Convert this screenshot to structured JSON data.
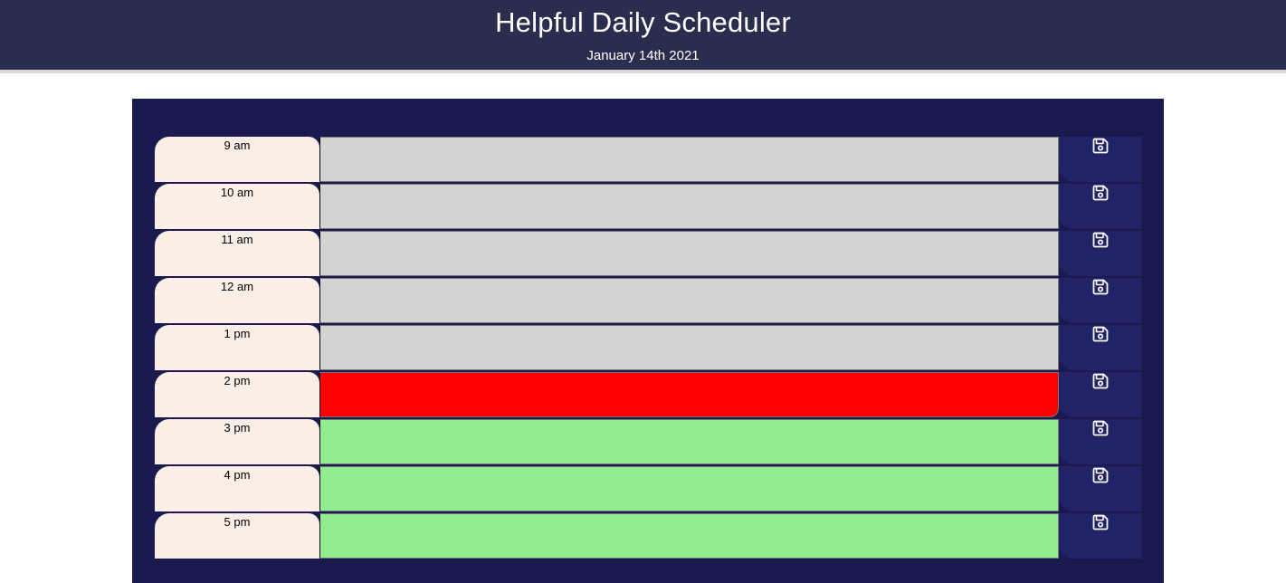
{
  "header": {
    "title": "Helpful Daily Scheduler",
    "date": "January 14th 2021"
  },
  "colors": {
    "header_bg": "#2a2d4e",
    "container_bg": "#1a1a4e",
    "hour_bg": "#f9efe6",
    "past": "#d3d3d3",
    "present": "#ff0000",
    "future": "#90ee90",
    "save_bg": "#222266"
  },
  "time_blocks": [
    {
      "hour": "9 am",
      "status": "past",
      "text": "",
      "save_icon": "save-icon"
    },
    {
      "hour": "10 am",
      "status": "past",
      "text": "",
      "save_icon": "save-icon"
    },
    {
      "hour": "11 am",
      "status": "past",
      "text": "",
      "save_icon": "save-icon"
    },
    {
      "hour": "12 am",
      "status": "past",
      "text": "",
      "save_icon": "save-icon"
    },
    {
      "hour": "1 pm",
      "status": "past",
      "text": "",
      "save_icon": "save-icon"
    },
    {
      "hour": "2 pm",
      "status": "present",
      "text": "",
      "save_icon": "save-icon"
    },
    {
      "hour": "3 pm",
      "status": "future",
      "text": "",
      "save_icon": "save-icon"
    },
    {
      "hour": "4 pm",
      "status": "future",
      "text": "",
      "save_icon": "save-icon"
    },
    {
      "hour": "5 pm",
      "status": "future",
      "text": "",
      "save_icon": "save-icon"
    }
  ]
}
